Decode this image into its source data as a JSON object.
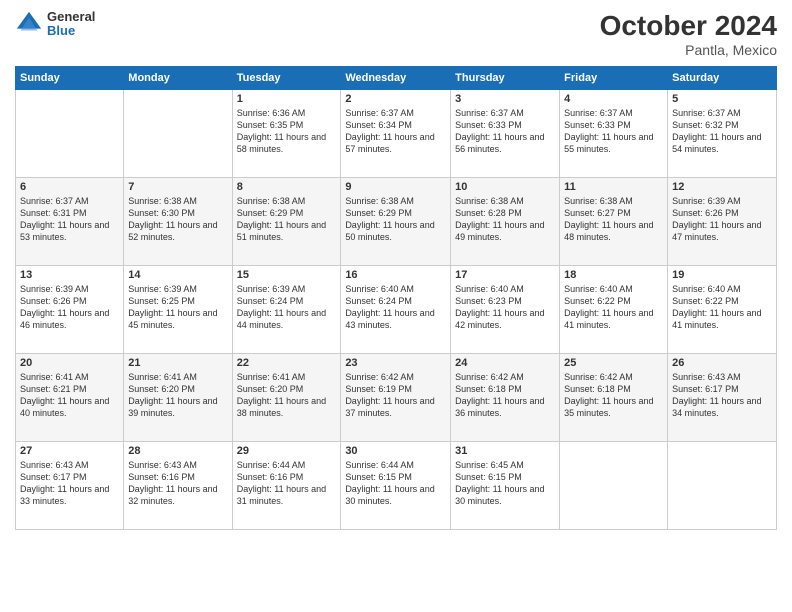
{
  "header": {
    "logo": {
      "general": "General",
      "blue": "Blue"
    },
    "title": "October 2024",
    "subtitle": "Pantla, Mexico"
  },
  "columns": [
    "Sunday",
    "Monday",
    "Tuesday",
    "Wednesday",
    "Thursday",
    "Friday",
    "Saturday"
  ],
  "weeks": [
    [
      {
        "day": "",
        "info": ""
      },
      {
        "day": "",
        "info": ""
      },
      {
        "day": "1",
        "info": "Sunrise: 6:36 AM\nSunset: 6:35 PM\nDaylight: 11 hours and 58 minutes."
      },
      {
        "day": "2",
        "info": "Sunrise: 6:37 AM\nSunset: 6:34 PM\nDaylight: 11 hours and 57 minutes."
      },
      {
        "day": "3",
        "info": "Sunrise: 6:37 AM\nSunset: 6:33 PM\nDaylight: 11 hours and 56 minutes."
      },
      {
        "day": "4",
        "info": "Sunrise: 6:37 AM\nSunset: 6:33 PM\nDaylight: 11 hours and 55 minutes."
      },
      {
        "day": "5",
        "info": "Sunrise: 6:37 AM\nSunset: 6:32 PM\nDaylight: 11 hours and 54 minutes."
      }
    ],
    [
      {
        "day": "6",
        "info": "Sunrise: 6:37 AM\nSunset: 6:31 PM\nDaylight: 11 hours and 53 minutes."
      },
      {
        "day": "7",
        "info": "Sunrise: 6:38 AM\nSunset: 6:30 PM\nDaylight: 11 hours and 52 minutes."
      },
      {
        "day": "8",
        "info": "Sunrise: 6:38 AM\nSunset: 6:29 PM\nDaylight: 11 hours and 51 minutes."
      },
      {
        "day": "9",
        "info": "Sunrise: 6:38 AM\nSunset: 6:29 PM\nDaylight: 11 hours and 50 minutes."
      },
      {
        "day": "10",
        "info": "Sunrise: 6:38 AM\nSunset: 6:28 PM\nDaylight: 11 hours and 49 minutes."
      },
      {
        "day": "11",
        "info": "Sunrise: 6:38 AM\nSunset: 6:27 PM\nDaylight: 11 hours and 48 minutes."
      },
      {
        "day": "12",
        "info": "Sunrise: 6:39 AM\nSunset: 6:26 PM\nDaylight: 11 hours and 47 minutes."
      }
    ],
    [
      {
        "day": "13",
        "info": "Sunrise: 6:39 AM\nSunset: 6:26 PM\nDaylight: 11 hours and 46 minutes."
      },
      {
        "day": "14",
        "info": "Sunrise: 6:39 AM\nSunset: 6:25 PM\nDaylight: 11 hours and 45 minutes."
      },
      {
        "day": "15",
        "info": "Sunrise: 6:39 AM\nSunset: 6:24 PM\nDaylight: 11 hours and 44 minutes."
      },
      {
        "day": "16",
        "info": "Sunrise: 6:40 AM\nSunset: 6:24 PM\nDaylight: 11 hours and 43 minutes."
      },
      {
        "day": "17",
        "info": "Sunrise: 6:40 AM\nSunset: 6:23 PM\nDaylight: 11 hours and 42 minutes."
      },
      {
        "day": "18",
        "info": "Sunrise: 6:40 AM\nSunset: 6:22 PM\nDaylight: 11 hours and 41 minutes."
      },
      {
        "day": "19",
        "info": "Sunrise: 6:40 AM\nSunset: 6:22 PM\nDaylight: 11 hours and 41 minutes."
      }
    ],
    [
      {
        "day": "20",
        "info": "Sunrise: 6:41 AM\nSunset: 6:21 PM\nDaylight: 11 hours and 40 minutes."
      },
      {
        "day": "21",
        "info": "Sunrise: 6:41 AM\nSunset: 6:20 PM\nDaylight: 11 hours and 39 minutes."
      },
      {
        "day": "22",
        "info": "Sunrise: 6:41 AM\nSunset: 6:20 PM\nDaylight: 11 hours and 38 minutes."
      },
      {
        "day": "23",
        "info": "Sunrise: 6:42 AM\nSunset: 6:19 PM\nDaylight: 11 hours and 37 minutes."
      },
      {
        "day": "24",
        "info": "Sunrise: 6:42 AM\nSunset: 6:18 PM\nDaylight: 11 hours and 36 minutes."
      },
      {
        "day": "25",
        "info": "Sunrise: 6:42 AM\nSunset: 6:18 PM\nDaylight: 11 hours and 35 minutes."
      },
      {
        "day": "26",
        "info": "Sunrise: 6:43 AM\nSunset: 6:17 PM\nDaylight: 11 hours and 34 minutes."
      }
    ],
    [
      {
        "day": "27",
        "info": "Sunrise: 6:43 AM\nSunset: 6:17 PM\nDaylight: 11 hours and 33 minutes."
      },
      {
        "day": "28",
        "info": "Sunrise: 6:43 AM\nSunset: 6:16 PM\nDaylight: 11 hours and 32 minutes."
      },
      {
        "day": "29",
        "info": "Sunrise: 6:44 AM\nSunset: 6:16 PM\nDaylight: 11 hours and 31 minutes."
      },
      {
        "day": "30",
        "info": "Sunrise: 6:44 AM\nSunset: 6:15 PM\nDaylight: 11 hours and 30 minutes."
      },
      {
        "day": "31",
        "info": "Sunrise: 6:45 AM\nSunset: 6:15 PM\nDaylight: 11 hours and 30 minutes."
      },
      {
        "day": "",
        "info": ""
      },
      {
        "day": "",
        "info": ""
      }
    ]
  ]
}
